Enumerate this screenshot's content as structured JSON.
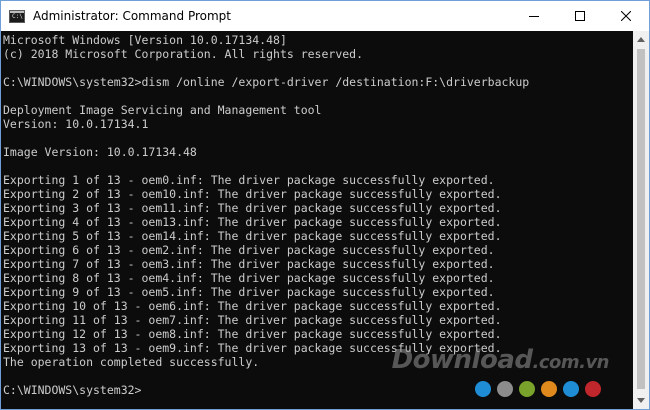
{
  "window": {
    "title": "Administrator: Command Prompt",
    "icon_text": "C:\\"
  },
  "controls": {
    "minimize_icon": "minimize-icon",
    "maximize_icon": "maximize-icon",
    "close_icon": "close-icon"
  },
  "console": {
    "lines": [
      "Microsoft Windows [Version 10.0.17134.48]",
      "(c) 2018 Microsoft Corporation. All rights reserved.",
      "",
      "C:\\WINDOWS\\system32>dism /online /export-driver /destination:F:\\driverbackup",
      "",
      "Deployment Image Servicing and Management tool",
      "Version: 10.0.17134.1",
      "",
      "Image Version: 10.0.17134.48",
      "",
      "Exporting 1 of 13 - oem0.inf: The driver package successfully exported.",
      "Exporting 2 of 13 - oem10.inf: The driver package successfully exported.",
      "Exporting 3 of 13 - oem11.inf: The driver package successfully exported.",
      "Exporting 4 of 13 - oem13.inf: The driver package successfully exported.",
      "Exporting 5 of 13 - oem14.inf: The driver package successfully exported.",
      "Exporting 6 of 13 - oem2.inf: The driver package successfully exported.",
      "Exporting 7 of 13 - oem3.inf: The driver package successfully exported.",
      "Exporting 8 of 13 - oem4.inf: The driver package successfully exported.",
      "Exporting 9 of 13 - oem5.inf: The driver package successfully exported.",
      "Exporting 10 of 13 - oem6.inf: The driver package successfully exported.",
      "Exporting 11 of 13 - oem7.inf: The driver package successfully exported.",
      "Exporting 12 of 13 - oem8.inf: The driver package successfully exported.",
      "Exporting 13 of 13 - oem9.inf: The driver package successfully exported.",
      "The operation completed successfully.",
      "",
      "C:\\WINDOWS\\system32>"
    ]
  },
  "watermark": {
    "text": "Download",
    "suffix": ".com.vn",
    "dot_colors": [
      "#1f8dd6",
      "#8c8c8c",
      "#7aa32b",
      "#e08a1e",
      "#1f8dd6",
      "#c0272d"
    ]
  },
  "colors": {
    "console_bg": "#0c0c0c",
    "console_fg": "#cccccc"
  }
}
